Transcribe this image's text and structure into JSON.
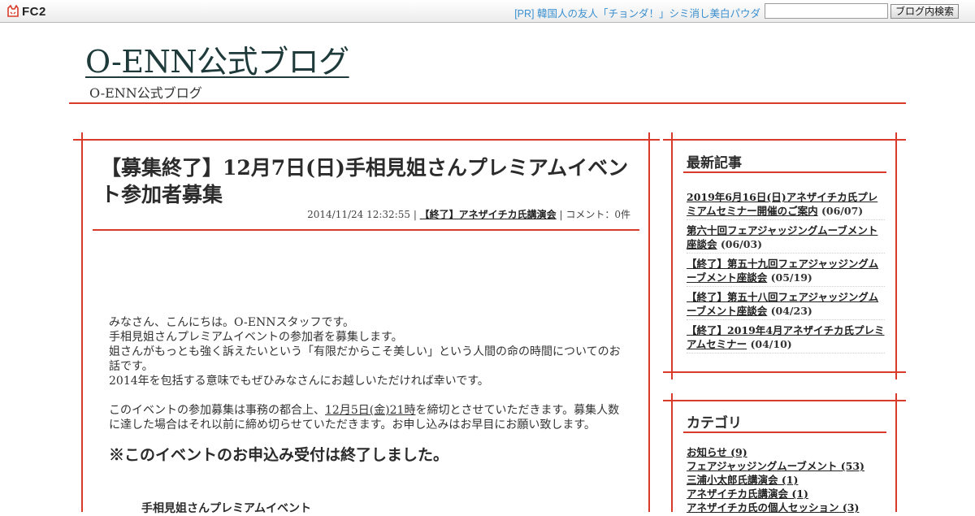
{
  "fc2bar": {
    "logo_text": "FC2",
    "pr_text": "[PR] 韓国人の友人「チョンダ！」シミ消し美白パウダ",
    "search_placeholder": "",
    "search_button": "ブログ内検索"
  },
  "header": {
    "blog_title": "O-ENN公式ブログ",
    "blog_description": "O-ENN公式ブログ"
  },
  "entry": {
    "title": "【募集終了】12月7日(日)手相見姐さんプレミアムイベント参加者募集",
    "date": "2014/11/24 12:32:55",
    "sep1": " | ",
    "category": "【終了】アネザイチカ氏講演会",
    "sep2": " | ",
    "comments": "コメント：0件",
    "body": {
      "line1": "みなさん、こんにちは。O-ENNスタッフです。",
      "line2": "手相見姐さんプレミアムイベントの参加者を募集します。",
      "line3": "姐さんがもっとも強く訴えたいという「有限だからこそ美しい」という人間の命の時間についてのお話です。",
      "line4": "2014年を包括する意味でもぜひみなさんにお越しいただければ幸いです。",
      "deadline_pre": "このイベントの参加募集は事務の都合上、",
      "deadline_date": "12月5日(金)21時",
      "deadline_post": "を締切とさせていただきます。募集人数に達した場合はそれ以前に締め切らせていただきます。お申し込みはお早目にお願い致します。"
    },
    "notice": "※このイベントのお申込み受付は終了しました。",
    "event_name": "手相見姐さんプレミアムイベント"
  },
  "sidebar": {
    "recent_heading": "最新記事",
    "recent": [
      {
        "title": "2019年6月16日(日)アネザイチカ氏プレミアムセミナー開催のご案内",
        "date": " (06/07)"
      },
      {
        "title": "第六十回フェアジャッジングムーブメント座談会",
        "date": " (06/03)"
      },
      {
        "title": "【終了】第五十九回フェアジャッジングムーブメント座談会",
        "date": " (05/19)"
      },
      {
        "title": "【終了】第五十八回フェアジャッジングムーブメント座談会",
        "date": " (04/23)"
      },
      {
        "title": "【終了】2019年4月アネザイチカ氏プレミアムセミナー",
        "date": " (04/10)"
      }
    ],
    "category_heading": "カテゴリ",
    "categories": [
      {
        "name": "お知らせ",
        "count": " (9)"
      },
      {
        "name": "フェアジャッジングムーブメント",
        "count": " (53)"
      },
      {
        "name": "三浦小太郎氏講演会",
        "count": " (1)"
      },
      {
        "name": "アネザイチカ氏講演会",
        "count": " (1)"
      },
      {
        "name": "アネザイチカ氏の個人セッション",
        "count": " (3)"
      }
    ]
  },
  "colors": {
    "accent_red": "#d93b2a",
    "pr_link": "#3a8fd0",
    "title_text": "#1f3a3a"
  }
}
